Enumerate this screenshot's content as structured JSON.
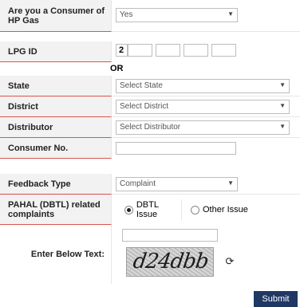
{
  "consumer": {
    "label": "Are you a Consumer of HP Gas",
    "value": "Yes"
  },
  "lpg": {
    "label": "LPG ID",
    "digits": [
      "2",
      "",
      "",
      "",
      ""
    ]
  },
  "or_text": "OR",
  "state": {
    "label": "State",
    "placeholder": "Select State"
  },
  "district": {
    "label": "District",
    "placeholder": "Select District"
  },
  "distributor": {
    "label": "Distributor",
    "placeholder": "Select Distributor"
  },
  "consumer_no": {
    "label": "Consumer No.",
    "value": ""
  },
  "feedback_type": {
    "label": "Feedback Type",
    "value": "Complaint"
  },
  "pahal": {
    "label": "PAHAL (DBTL) related complaints",
    "options": [
      {
        "label": "DBTL Issue",
        "selected": true
      },
      {
        "label": "Other Issue",
        "selected": false
      }
    ]
  },
  "captcha": {
    "label": "Enter Below Text:",
    "input_value": "",
    "image_text": "d24dbb",
    "refresh_icon": "refresh-icon"
  },
  "submit_label": "Submit"
}
